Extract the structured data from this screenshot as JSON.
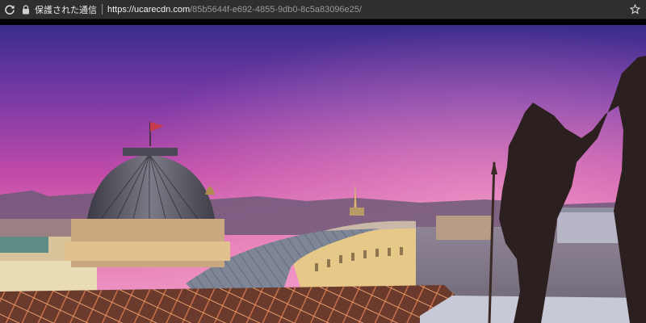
{
  "browser": {
    "secure_label": "保護された通信",
    "url_host": "https://ucarecdn.com",
    "url_path": "/85b5644f-e692-4855-9db0-8c5a83096e25/",
    "icons": {
      "reload": "reload-icon",
      "lock": "lock-icon",
      "bookmark": "star-icon"
    },
    "colors": {
      "toolbar": "#2f2f2f",
      "text": "#e8e8e8",
      "path_text": "#9a9a9a"
    }
  },
  "content": {
    "image_description_colors": {
      "sky_top": "#3a2c8c",
      "sky_mid": "#c14aa8",
      "sky_horizon": "#f1a2c9"
    }
  }
}
